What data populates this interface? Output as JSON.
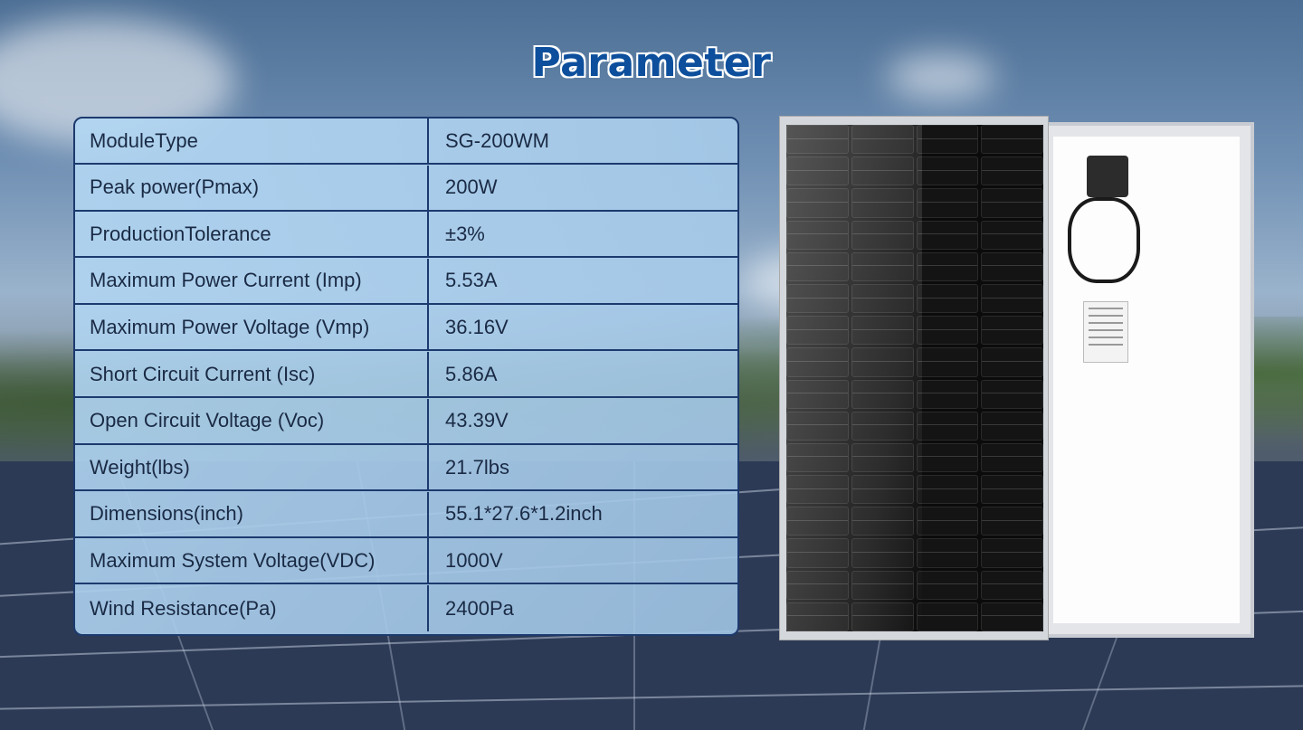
{
  "title": "Parameter",
  "params": [
    {
      "label": "ModuleType",
      "value": "SG-200WM"
    },
    {
      "label": "Peak power(Pmax)",
      "value": "200W"
    },
    {
      "label": "ProductionTolerance",
      "value": "±3%"
    },
    {
      "label": "Maximum Power Current (Imp)",
      "value": "5.53A"
    },
    {
      "label": "Maximum Power Voltage (Vmp)",
      "value": "36.16V"
    },
    {
      "label": "Short Circuit Current (Isc)",
      "value": "5.86A"
    },
    {
      "label": "Open Circuit Voltage (Voc)",
      "value": "43.39V"
    },
    {
      "label": "Weight(lbs)",
      "value": "21.7lbs"
    },
    {
      "label": "Dimensions(inch)",
      "value": "55.1*27.6*1.2inch"
    },
    {
      "label": "Maximum System Voltage(VDC)",
      "value": "1000V"
    },
    {
      "label": "Wind Resistance(Pa)",
      "value": "2400Pa"
    }
  ],
  "colors": {
    "title": "#0d4f9c",
    "table_border": "#1d3a6e",
    "table_fill": "#b2d6f2"
  }
}
